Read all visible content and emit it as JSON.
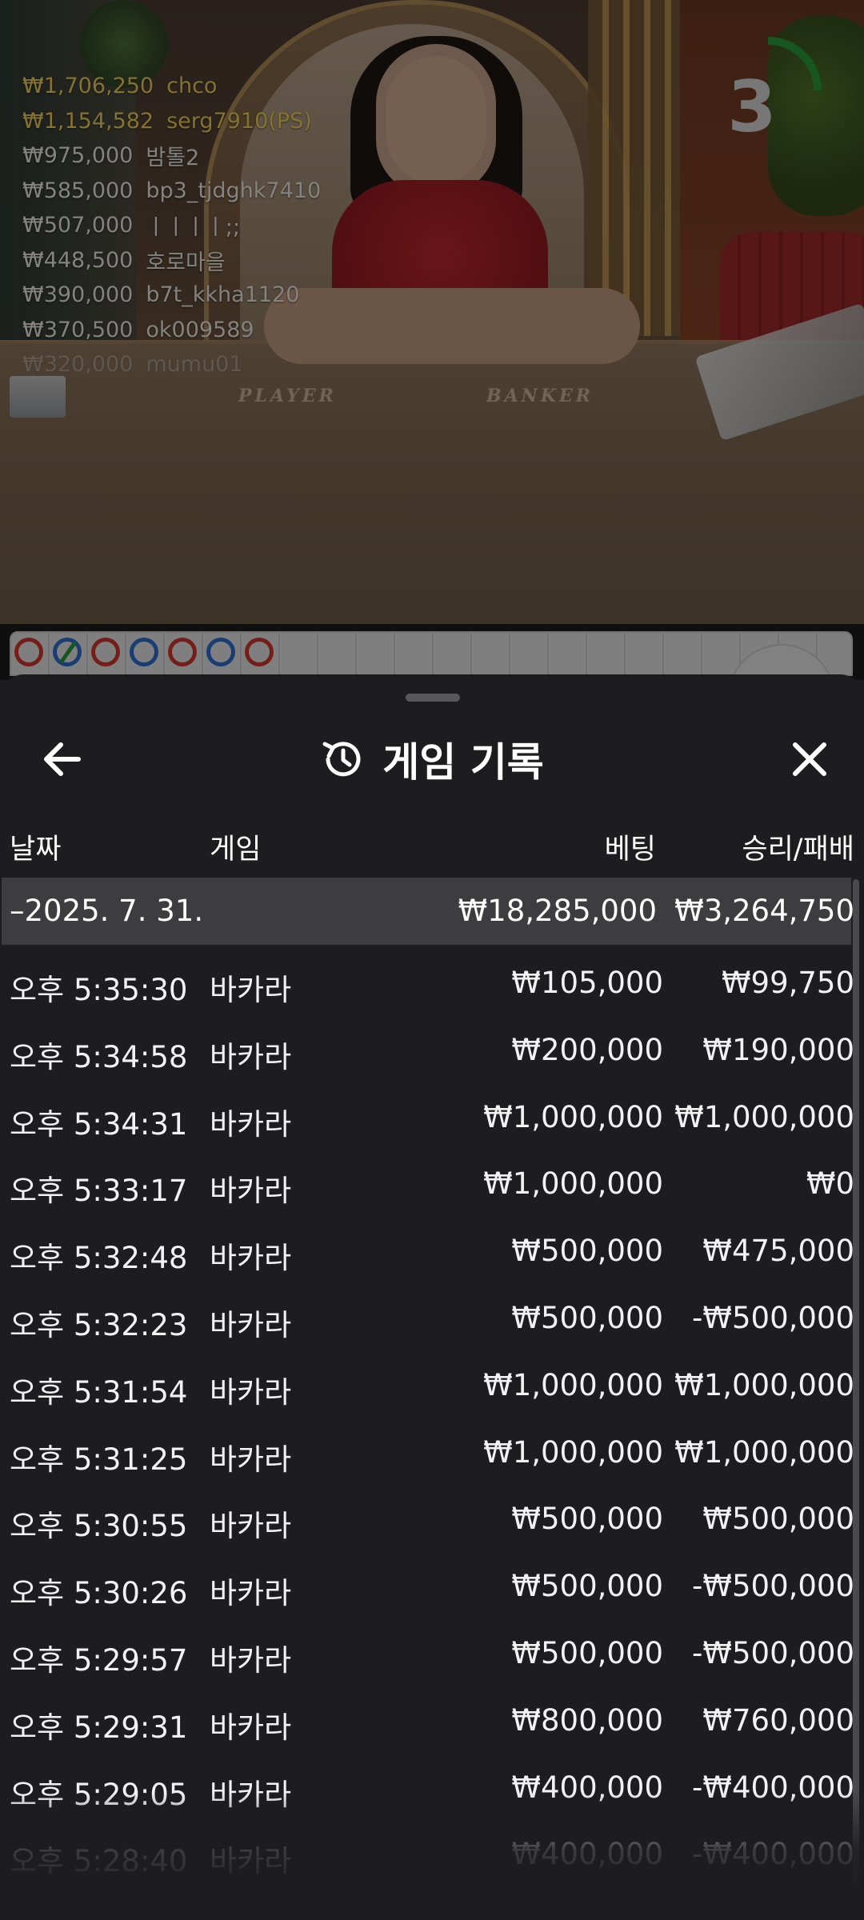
{
  "winners": [
    {
      "amount": "₩1,706,250",
      "name": "chco",
      "style": "gold"
    },
    {
      "amount": "₩1,154,582",
      "name": "serg7910(PS)",
      "style": "gold"
    },
    {
      "amount": "₩975,000",
      "name": "밤톨2",
      "style": "plain"
    },
    {
      "amount": "₩585,000",
      "name": "bp3_tjdghk7410",
      "style": "plain"
    },
    {
      "amount": "₩507,000",
      "name": "ㅣㅣㅣㅣ;;",
      "style": "plain"
    },
    {
      "amount": "₩448,500",
      "name": "호로마을",
      "style": "plain"
    },
    {
      "amount": "₩390,000",
      "name": "b7t_kkha1120",
      "style": "plain"
    },
    {
      "amount": "₩370,500",
      "name": "ok009589",
      "style": "plain"
    },
    {
      "amount": "₩320,000",
      "name": "mumu01",
      "style": "faded"
    }
  ],
  "table": {
    "player_label": "PLAYER",
    "banker_label": "BANKER"
  },
  "countdown": {
    "value": "3",
    "progress": 0.25,
    "color": "#2a9d3b"
  },
  "roadmap": {
    "beads": [
      "banker",
      "player-tie",
      "banker",
      "player",
      "banker",
      "player",
      "banker"
    ],
    "colors": {
      "banker": "#d5372f",
      "player": "#2f6fd0",
      "tie": "#2a9d3b"
    }
  },
  "sheet": {
    "title": "게임 기록",
    "back_icon": "arrow-left-icon",
    "history_icon": "history-icon",
    "close_icon": "close-icon"
  },
  "columns": {
    "date": "날짜",
    "game": "게임",
    "bet": "베팅",
    "result": "승리/패배"
  },
  "date_group": {
    "date": "–2025. 7. 31.",
    "bet_total": "₩18,285,000",
    "result_total": "₩3,264,750"
  },
  "rows": [
    {
      "time": "오후 5:35:30",
      "game": "바카라",
      "bet": "₩105,000",
      "result": "₩99,750"
    },
    {
      "time": "오후 5:34:58",
      "game": "바카라",
      "bet": "₩200,000",
      "result": "₩190,000"
    },
    {
      "time": "오후 5:34:31",
      "game": "바카라",
      "bet": "₩1,000,000",
      "result": "₩1,000,000"
    },
    {
      "time": "오후 5:33:17",
      "game": "바카라",
      "bet": "₩1,000,000",
      "result": "₩0"
    },
    {
      "time": "오후 5:32:48",
      "game": "바카라",
      "bet": "₩500,000",
      "result": "₩475,000"
    },
    {
      "time": "오후 5:32:23",
      "game": "바카라",
      "bet": "₩500,000",
      "result": "-₩500,000"
    },
    {
      "time": "오후 5:31:54",
      "game": "바카라",
      "bet": "₩1,000,000",
      "result": "₩1,000,000"
    },
    {
      "time": "오후 5:31:25",
      "game": "바카라",
      "bet": "₩1,000,000",
      "result": "₩1,000,000"
    },
    {
      "time": "오후 5:30:55",
      "game": "바카라",
      "bet": "₩500,000",
      "result": "₩500,000"
    },
    {
      "time": "오후 5:30:26",
      "game": "바카라",
      "bet": "₩500,000",
      "result": "-₩500,000"
    },
    {
      "time": "오후 5:29:57",
      "game": "바카라",
      "bet": "₩500,000",
      "result": "-₩500,000"
    },
    {
      "time": "오후 5:29:31",
      "game": "바카라",
      "bet": "₩800,000",
      "result": "₩760,000"
    },
    {
      "time": "오후 5:29:05",
      "game": "바카라",
      "bet": "₩400,000",
      "result": "-₩400,000"
    },
    {
      "time": "오후 5:28:40",
      "game": "바카라",
      "bet": "₩400,000",
      "result": "-₩400,000"
    }
  ]
}
